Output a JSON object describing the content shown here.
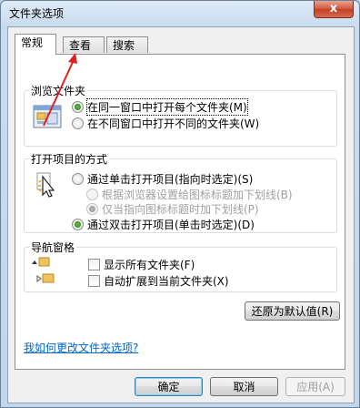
{
  "window": {
    "title": "文件夹选项",
    "close_label": "x"
  },
  "tabs": [
    {
      "label": "常规",
      "active": true
    },
    {
      "label": "查看",
      "active": false
    },
    {
      "label": "搜索",
      "active": false
    }
  ],
  "browse": {
    "title": "浏览文件夹",
    "options": [
      "在同一窗口中打开每个文件夹(M)",
      "在不同窗口中打开不同的文件夹(W)"
    ],
    "selected": 0
  },
  "click": {
    "title": "打开项目的方式",
    "single": "通过单击打开项目(指向时选定)(S)",
    "sub1": "根据浏览器设置给图标标题加下划线(B)",
    "sub2": "仅当指向图标标题时加下划线(P)",
    "double": "通过双击打开项目(单击时选定)(D)"
  },
  "nav": {
    "title": "导航窗格",
    "show_all": "显示所有文件夹(F)",
    "auto_expand": "自动扩展到当前文件夹(X)"
  },
  "restore_button": "还原为默认值(R)",
  "help_link": "我如何更改文件夹选项?",
  "buttons": {
    "ok": "确定",
    "cancel": "取消",
    "apply": "应用(A)"
  },
  "colors": {
    "annotation_arrow": "#e02020",
    "link": "#0066cc"
  }
}
